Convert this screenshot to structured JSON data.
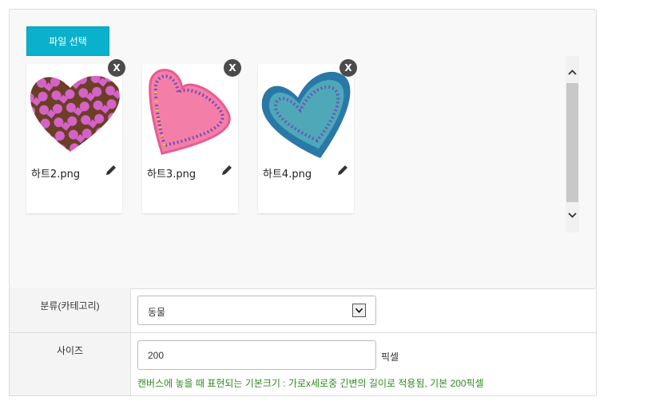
{
  "upload": {
    "file_button_label": "파일 선택",
    "files": [
      {
        "name": "하트2.png",
        "remove_label": "X",
        "thumbnail": "checkered-heart-image"
      },
      {
        "name": "하트3.png",
        "remove_label": "X",
        "thumbnail": "pink-heart-image"
      },
      {
        "name": "하트4.png",
        "remove_label": "X",
        "thumbnail": "teal-heart-image"
      }
    ],
    "edit_icon": "pencil-icon"
  },
  "form": {
    "category": {
      "label": "분류(카테고리)",
      "selected": "동물"
    },
    "size": {
      "label": "사이즈",
      "value": "200",
      "unit": "픽셀",
      "hint": "캔버스에 놓을 때 표현되는 기본크기 : 가로x세로중 긴변의 길이로 적용됨, 기본 200픽셀"
    }
  },
  "colors": {
    "button": "#0ab1cc",
    "hint": "#2e8b1f",
    "remove_badge": "#4b4b4b"
  }
}
